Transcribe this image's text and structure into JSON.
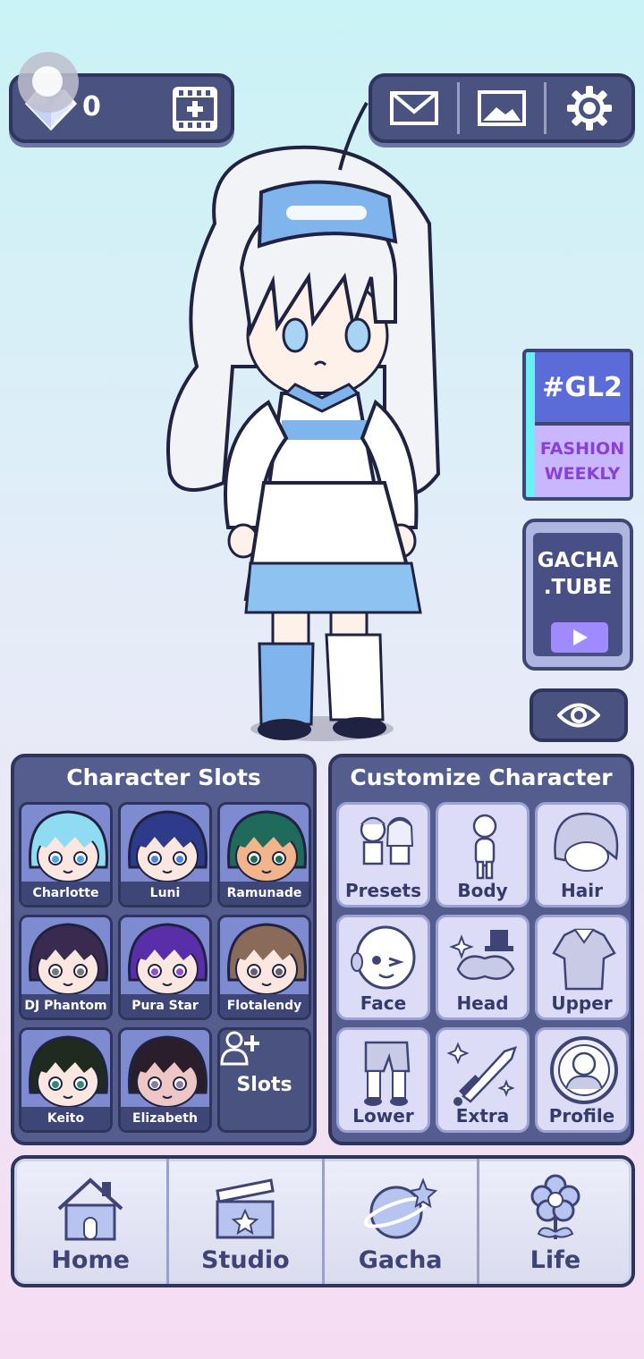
{
  "currency": {
    "gems": "0",
    "gem_icon": "diamond-icon",
    "video_icon": "film-plus-icon"
  },
  "toolbar": {
    "icons": [
      "mail-icon",
      "image-icon",
      "gear-icon"
    ]
  },
  "side": {
    "gl2_title": "#GL2",
    "gl2_line1": "FASHION",
    "gl2_line2": "WEEKLY",
    "tube_line1": "GACHA",
    "tube_line2": ".TUBE",
    "eye_icon": "eye-icon"
  },
  "slots_panel": {
    "title": "Character Slots",
    "slots": [
      {
        "name": "Charlotte",
        "hair": "#8fdcf2",
        "skin": "#fbe7df",
        "eye": "#4aa6e6"
      },
      {
        "name": "Luni",
        "hair": "#2d3b8a",
        "skin": "#fbe7df",
        "eye": "#4a86e6"
      },
      {
        "name": "Ramunade",
        "hair": "#1f6a5a",
        "skin": "#f2b48a",
        "eye": "#1e6f5a"
      },
      {
        "name": "DJ Phantom",
        "hair": "#3a2a50",
        "skin": "#fbe7df",
        "eye": "#777777"
      },
      {
        "name": "Pura Star",
        "hair": "#5a2ea8",
        "skin": "#fbe7df",
        "eye": "#9a4ad8"
      },
      {
        "name": "Flotalendy",
        "hair": "#8a6a58",
        "skin": "#fbe7df",
        "eye": "#6a5a6a"
      },
      {
        "name": "Keito",
        "hair": "#1e2b1e",
        "skin": "#fbe7df",
        "eye": "#2e8a7a"
      },
      {
        "name": "Elizabeth",
        "hair": "#2a1e2a",
        "skin": "#eec6c6",
        "eye": "#8a7aa8"
      }
    ],
    "add_label": "Slots"
  },
  "customize_panel": {
    "title": "Customize Character",
    "tiles": [
      {
        "label": "Presets",
        "icon": "presets-icon"
      },
      {
        "label": "Body",
        "icon": "body-icon"
      },
      {
        "label": "Hair",
        "icon": "hair-icon"
      },
      {
        "label": "Face",
        "icon": "face-icon"
      },
      {
        "label": "Head",
        "icon": "head-accessory-icon"
      },
      {
        "label": "Upper",
        "icon": "shirt-icon"
      },
      {
        "label": "Lower",
        "icon": "pants-icon"
      },
      {
        "label": "Extra",
        "icon": "sword-icon"
      },
      {
        "label": "Profile",
        "icon": "profile-icon"
      }
    ]
  },
  "nav": [
    {
      "label": "Home",
      "icon": "house-icon"
    },
    {
      "label": "Studio",
      "icon": "clapperboard-icon"
    },
    {
      "label": "Gacha",
      "icon": "gacha-planet-icon"
    },
    {
      "label": "Life",
      "icon": "flower-icon"
    }
  ]
}
